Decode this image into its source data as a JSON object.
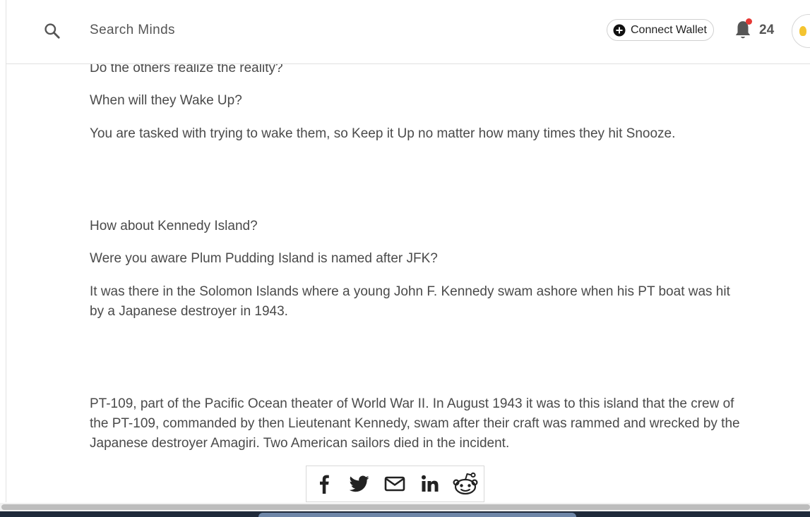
{
  "header": {
    "search_placeholder": "Search Minds",
    "connect_wallet_label": "Connect Wallet",
    "notification_count": "24",
    "notification_dot_color": "#e53935"
  },
  "icons": {
    "search": "search-icon",
    "wallet": "plus-circle-icon",
    "notifications": "bell-icon",
    "avatar": "lightbulb-icon"
  },
  "article": {
    "paragraphs": [
      "Do the others realize the reality?",
      "When will they Wake Up?",
      "You are tasked with trying to wake them, so Keep it Up no matter how many times they hit Snooze.",
      "How about Kennedy Island?",
      "Were you aware Plum Pudding Island is named after JFK?",
      "It was there in the Solomon Islands where a young John F. Kennedy swam ashore when his PT boat was hit by a Japanese destroyer in 1943.",
      "PT-109, part of the Pacific Ocean theater of World War II. In August 1943 it was to this island that the crew of the PT-109, commanded by then Lieutenant Kennedy, swam after their craft was rammed and wrecked by the Japanese destroyer Amagiri. Two American sailors died in the incident."
    ]
  },
  "share": {
    "buttons": [
      "facebook-icon",
      "twitter-icon",
      "email-icon",
      "linkedin-icon",
      "reddit-icon"
    ]
  }
}
